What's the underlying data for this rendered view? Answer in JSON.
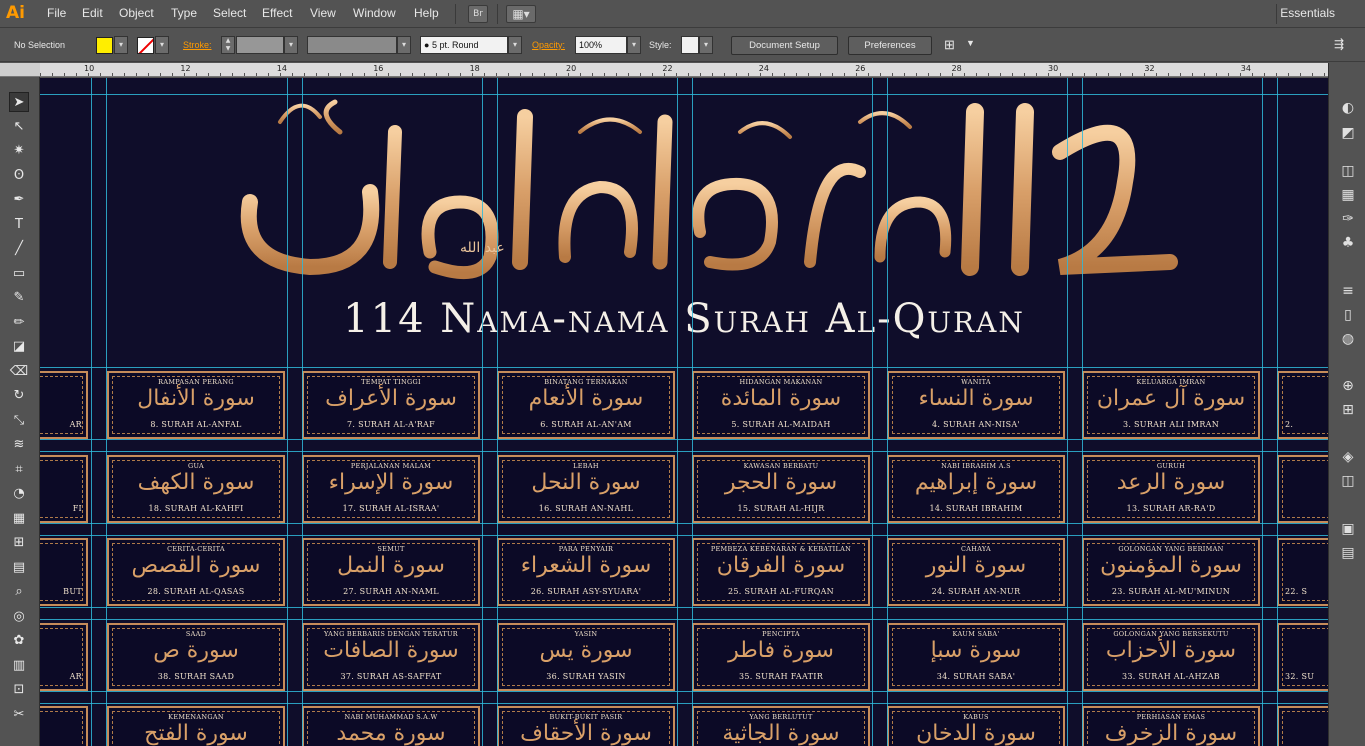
{
  "app": {
    "logo": "Ai"
  },
  "menu": [
    "File",
    "Edit",
    "Object",
    "Type",
    "Select",
    "Effect",
    "View",
    "Window",
    "Help"
  ],
  "menubar_buttons": {
    "bridge": "Br",
    "arrange": "▦▾"
  },
  "workspace": "Essentials",
  "control": {
    "selection": "No Selection",
    "stroke_label": "Stroke:",
    "brush": "5 pt. Round",
    "opacity_label": "Opacity:",
    "opacity_value": "100%",
    "style_label": "Style:",
    "document_setup": "Document Setup",
    "preferences": "Preferences"
  },
  "ruler": [
    "10",
    "12",
    "14",
    "16",
    "18",
    "20",
    "22",
    "24",
    "26",
    "28",
    "30",
    "32",
    "34"
  ],
  "header": {
    "arabic": "١١٤ نام سورة القرآن",
    "title": "114 Nama-nama Surah Al-Quran"
  },
  "cards": [
    {
      "meaning": "Rampasan Perang",
      "ar": "سورة الأنفال",
      "name": "8. Surah Al-Anfal"
    },
    {
      "meaning": "Tempat Tinggi",
      "ar": "سورة الأعراف",
      "name": "7. Surah Al-A'raf"
    },
    {
      "meaning": "Binatang Ternakan",
      "ar": "سورة الأنعام",
      "name": "6. Surah Al-An'am"
    },
    {
      "meaning": "Hidangan Makanan",
      "ar": "سورة المائدة",
      "name": "5. Surah Al-Maidah"
    },
    {
      "meaning": "Wanita",
      "ar": "سورة النساء",
      "name": "4. Surah An-Nisa'"
    },
    {
      "meaning": "Keluarga Imran",
      "ar": "سورة آل عمران",
      "name": "3. Surah Ali Imran"
    },
    {
      "meaning": "Gua",
      "ar": "سورة الكهف",
      "name": "18. Surah Al-Kahfi"
    },
    {
      "meaning": "Perjalanan Malam",
      "ar": "سورة الإسراء",
      "name": "17. Surah Al-Israa'"
    },
    {
      "meaning": "Lebah",
      "ar": "سورة النحل",
      "name": "16. Surah An-Nahl"
    },
    {
      "meaning": "Kawasan Berbatu",
      "ar": "سورة الحجر",
      "name": "15. Surah Al-Hijr"
    },
    {
      "meaning": "Nabi Ibrahim A.S",
      "ar": "سورة إبراهيم",
      "name": "14. Surah Ibrahim"
    },
    {
      "meaning": "Guruh",
      "ar": "سورة الرعد",
      "name": "13. Surah Ar-Ra'd"
    },
    {
      "meaning": "Cerita-cerita",
      "ar": "سورة القصص",
      "name": "28. Surah Al-Qasas"
    },
    {
      "meaning": "Semut",
      "ar": "سورة النمل",
      "name": "27. Surah An-Naml"
    },
    {
      "meaning": "Para Penyair",
      "ar": "سورة الشعراء",
      "name": "26. Surah Asy-Syuara'"
    },
    {
      "meaning": "Pembeza Kebenaran & Kebatilan",
      "ar": "سورة الفرقان",
      "name": "25. Surah Al-Furqan"
    },
    {
      "meaning": "Cahaya",
      "ar": "سورة النور",
      "name": "24. Surah An-Nur"
    },
    {
      "meaning": "Golongan Yang Beriman",
      "ar": "سورة المؤمنون",
      "name": "23. Surah Al-Mu'minun"
    },
    {
      "meaning": "Saad",
      "ar": "سورة ص",
      "name": "38. Surah Saad"
    },
    {
      "meaning": "Yang Berbaris Dengan Teratur",
      "ar": "سورة الصافات",
      "name": "37. Surah As-Saffat"
    },
    {
      "meaning": "Yasin",
      "ar": "سورة يس",
      "name": "36. Surah Yasin"
    },
    {
      "meaning": "Pencipta",
      "ar": "سورة فاطر",
      "name": "35. Surah Faatir"
    },
    {
      "meaning": "Kaum Saba'",
      "ar": "سورة سبإ",
      "name": "34. Surah Saba'"
    },
    {
      "meaning": "Golongan Yang Bersekutu",
      "ar": "سورة الأحزاب",
      "name": "33. Surah Al-Ahzab"
    },
    {
      "meaning": "Kemenangan",
      "ar": "سورة الفتح",
      "name": ""
    },
    {
      "meaning": "Nabi Muhammad S.A.W",
      "ar": "سورة محمد",
      "name": ""
    },
    {
      "meaning": "Bukit-bukit Pasir",
      "ar": "سورة الأحقاف",
      "name": ""
    },
    {
      "meaning": "Yang Berlutut",
      "ar": "سورة الجاثية",
      "name": ""
    },
    {
      "meaning": "Kabus",
      "ar": "سورة الدخان",
      "name": ""
    },
    {
      "meaning": "Perhiasan Emas",
      "ar": "سورة الزخرف",
      "name": ""
    }
  ],
  "edge_fragments": {
    "left": [
      "AR",
      "FI",
      "BUT",
      "AR",
      ""
    ],
    "right": [
      "2.",
      "",
      "22. S",
      "32. SU",
      ""
    ]
  }
}
